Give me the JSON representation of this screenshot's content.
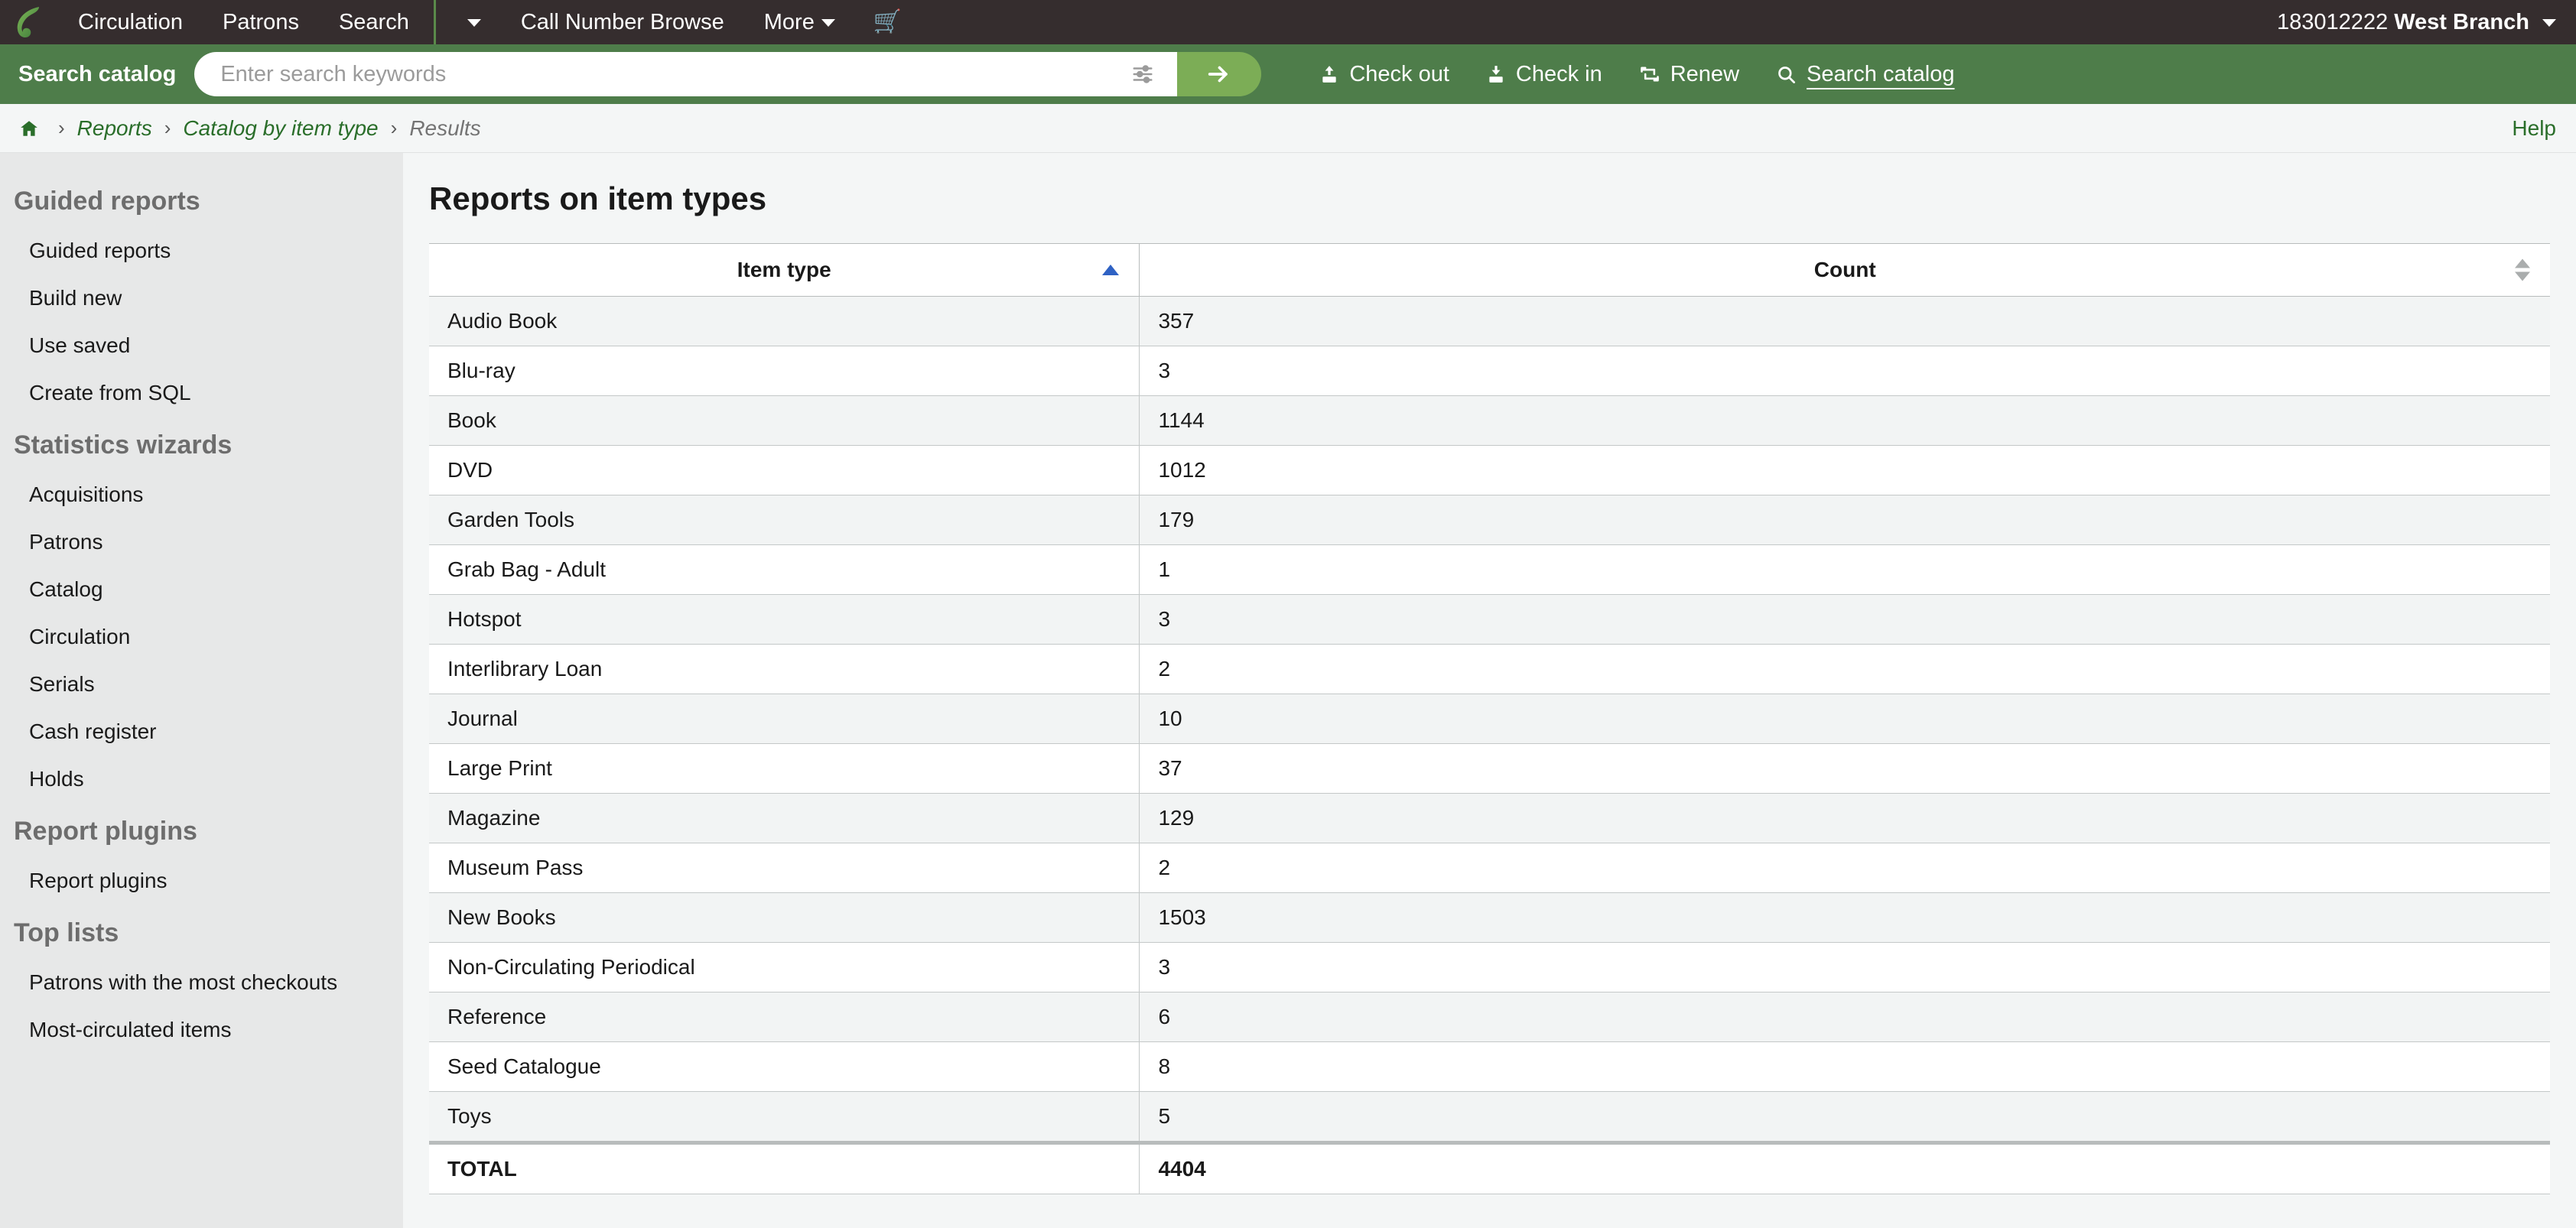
{
  "topnav": {
    "logo_alt": "koha-logo",
    "items": [
      {
        "label": "Circulation",
        "has_caret": false
      },
      {
        "label": "Patrons",
        "has_caret": false
      },
      {
        "label": "Search",
        "has_caret": false
      },
      {
        "label": "",
        "has_caret": true
      },
      {
        "label": "Call Number Browse",
        "has_caret": false
      },
      {
        "label": "More",
        "has_caret": true
      }
    ],
    "cart_icon": "shopping-cart-icon",
    "user": {
      "number": "183012222",
      "branch": "West Branch"
    }
  },
  "search": {
    "label": "Search catalog",
    "placeholder": "Enter search keywords",
    "value": "",
    "filter_icon": "sliders-icon",
    "submit_icon": "arrow-right-icon",
    "actions": [
      {
        "label": "Check out",
        "icon": "check-out-icon",
        "active": false
      },
      {
        "label": "Check in",
        "icon": "check-in-icon",
        "active": false
      },
      {
        "label": "Renew",
        "icon": "renew-icon",
        "active": false
      },
      {
        "label": "Search catalog",
        "icon": "search-icon",
        "active": true
      }
    ]
  },
  "breadcrumb": {
    "home_icon": "home-icon",
    "separator": "›",
    "items": [
      {
        "label": "Reports",
        "current": false
      },
      {
        "label": "Catalog by item type",
        "current": false
      },
      {
        "label": "Results",
        "current": true
      }
    ],
    "help_label": "Help"
  },
  "sidebar": {
    "groups": [
      {
        "heading": "Guided reports",
        "items": [
          "Guided reports",
          "Build new",
          "Use saved",
          "Create from SQL"
        ]
      },
      {
        "heading": "Statistics wizards",
        "items": [
          "Acquisitions",
          "Patrons",
          "Catalog",
          "Circulation",
          "Serials",
          "Cash register",
          "Holds"
        ]
      },
      {
        "heading": "Report plugins",
        "items": [
          "Report plugins"
        ]
      },
      {
        "heading": "Top lists",
        "items": [
          "Patrons with the most checkouts",
          "Most-circulated items"
        ]
      }
    ]
  },
  "main": {
    "title": "Reports on item types",
    "table": {
      "columns": [
        {
          "label": "Item type",
          "sort": "asc"
        },
        {
          "label": "Count",
          "sort": "none"
        }
      ],
      "rows": [
        {
          "item_type": "Audio Book",
          "count": "357"
        },
        {
          "item_type": "Blu-ray",
          "count": "3"
        },
        {
          "item_type": "Book",
          "count": "1144"
        },
        {
          "item_type": "DVD",
          "count": "1012"
        },
        {
          "item_type": "Garden Tools",
          "count": "179"
        },
        {
          "item_type": "Grab Bag - Adult",
          "count": "1"
        },
        {
          "item_type": "Hotspot",
          "count": "3"
        },
        {
          "item_type": "Interlibrary Loan",
          "count": "2"
        },
        {
          "item_type": "Journal",
          "count": "10"
        },
        {
          "item_type": "Large Print",
          "count": "37"
        },
        {
          "item_type": "Magazine",
          "count": "129"
        },
        {
          "item_type": "Museum Pass",
          "count": "2"
        },
        {
          "item_type": "New Books",
          "count": "1503"
        },
        {
          "item_type": "Non-Circulating Periodical",
          "count": "3"
        },
        {
          "item_type": "Reference",
          "count": "6"
        },
        {
          "item_type": "Seed Catalogue",
          "count": "8"
        },
        {
          "item_type": "Toys",
          "count": "5"
        }
      ],
      "total": {
        "label": "TOTAL",
        "count": "4404"
      }
    }
  },
  "colors": {
    "dark_bar": "#352d2e",
    "green_bar": "#4e7d4a",
    "submit_green": "#7cad56",
    "link_green": "#2a6e2a",
    "sidebar_bg": "#e7e8e8",
    "content_bg": "#f4f6f6",
    "sort_active": "#2f62c4"
  }
}
